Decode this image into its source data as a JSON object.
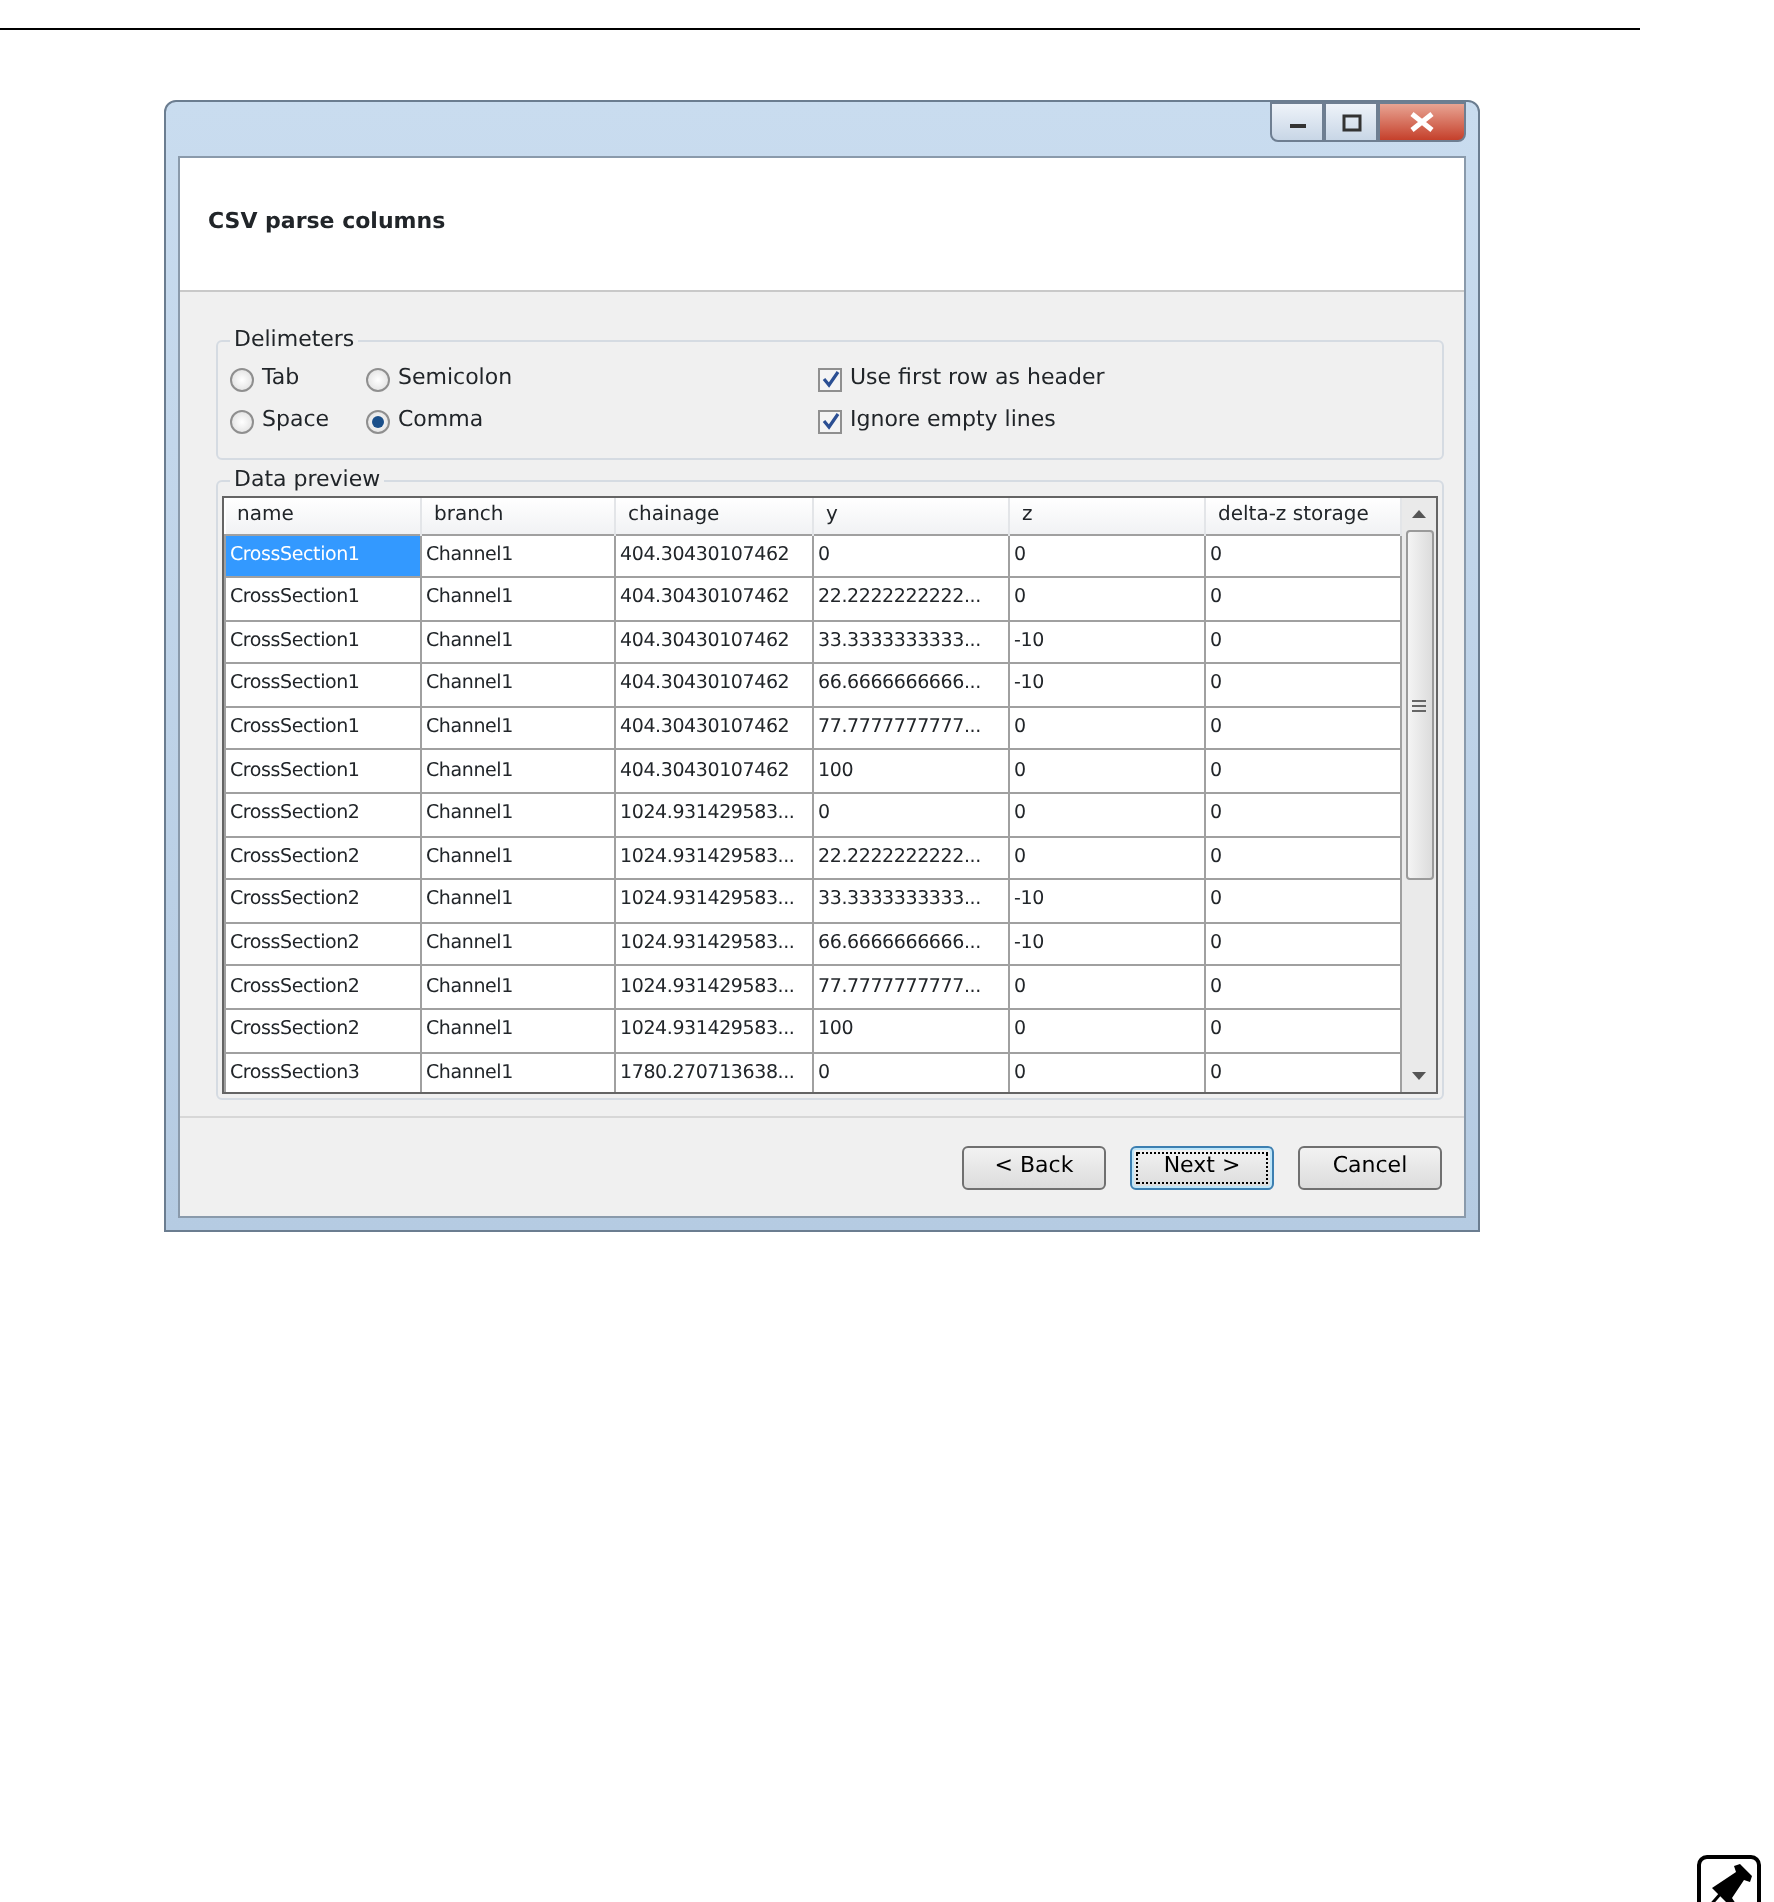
{
  "dialog": {
    "title": "CSV parse columns"
  },
  "delimiters": {
    "label": "Delimeters",
    "radios": [
      {
        "label": "Tab",
        "selected": false
      },
      {
        "label": "Semicolon",
        "selected": false
      },
      {
        "label": "Space",
        "selected": false
      },
      {
        "label": "Comma",
        "selected": true
      }
    ],
    "checkboxes": [
      {
        "label": "Use first row as header",
        "checked": true
      },
      {
        "label": "Ignore empty lines",
        "checked": true
      }
    ]
  },
  "preview": {
    "label": "Data preview",
    "columns": [
      "name",
      "branch",
      "chainage",
      "y",
      "z",
      "delta-z storage"
    ],
    "rows": [
      {
        "selected": true,
        "cells": [
          "CrossSection1",
          "Channel1",
          "404.30430107462",
          "0",
          "0",
          "0"
        ]
      },
      {
        "selected": false,
        "cells": [
          "CrossSection1",
          "Channel1",
          "404.30430107462",
          "22.2222222222...",
          "0",
          "0"
        ]
      },
      {
        "selected": false,
        "cells": [
          "CrossSection1",
          "Channel1",
          "404.30430107462",
          "33.3333333333...",
          "-10",
          "0"
        ]
      },
      {
        "selected": false,
        "cells": [
          "CrossSection1",
          "Channel1",
          "404.30430107462",
          "66.6666666666...",
          "-10",
          "0"
        ]
      },
      {
        "selected": false,
        "cells": [
          "CrossSection1",
          "Channel1",
          "404.30430107462",
          "77.7777777777...",
          "0",
          "0"
        ]
      },
      {
        "selected": false,
        "cells": [
          "CrossSection1",
          "Channel1",
          "404.30430107462",
          "100",
          "0",
          "0"
        ]
      },
      {
        "selected": false,
        "cells": [
          "CrossSection2",
          "Channel1",
          "1024.931429583...",
          "0",
          "0",
          "0"
        ]
      },
      {
        "selected": false,
        "cells": [
          "CrossSection2",
          "Channel1",
          "1024.931429583...",
          "22.2222222222...",
          "0",
          "0"
        ]
      },
      {
        "selected": false,
        "cells": [
          "CrossSection2",
          "Channel1",
          "1024.931429583...",
          "33.3333333333...",
          "-10",
          "0"
        ]
      },
      {
        "selected": false,
        "cells": [
          "CrossSection2",
          "Channel1",
          "1024.931429583...",
          "66.6666666666...",
          "-10",
          "0"
        ]
      },
      {
        "selected": false,
        "cells": [
          "CrossSection2",
          "Channel1",
          "1024.931429583...",
          "77.7777777777...",
          "0",
          "0"
        ]
      },
      {
        "selected": false,
        "cells": [
          "CrossSection2",
          "Channel1",
          "1024.931429583...",
          "100",
          "0",
          "0"
        ]
      },
      {
        "selected": false,
        "cells": [
          "CrossSection3",
          "Channel1",
          "1780.270713638...",
          "0",
          "0",
          "0"
        ]
      }
    ]
  },
  "buttons": [
    {
      "label": "< Back",
      "focused": false
    },
    {
      "label": "Next >",
      "focused": true
    },
    {
      "label": "Cancel",
      "focused": false
    }
  ]
}
